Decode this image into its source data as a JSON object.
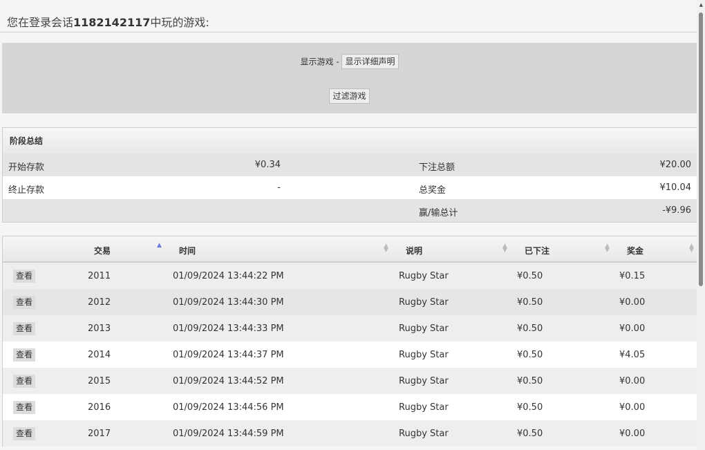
{
  "header": {
    "prefix": "您在登录会话",
    "session_id": "1182142117",
    "suffix": "中玩的游戏:"
  },
  "filter": {
    "show_games_label": "显示游戏 -",
    "show_details_button": "显示详细声明",
    "filter_button": "过滤游戏"
  },
  "summary": {
    "title": "阶段总结",
    "rows": [
      {
        "l1": "开始存款",
        "v1": "¥0.34",
        "l2": "下注总额",
        "v2": "¥20.00"
      },
      {
        "l1": "终止存款",
        "v1": "-",
        "l2": "总奖金",
        "v2": "¥10.04"
      },
      {
        "l1": "",
        "v1": "",
        "l2": "赢/输总计",
        "v2": "-¥9.96"
      }
    ]
  },
  "table": {
    "columns": [
      "交易",
      "时间",
      "说明",
      "已下注",
      "奖金"
    ],
    "view_label": "查看",
    "rows": [
      {
        "id": "2011",
        "time": "01/09/2024 13:44:22 PM",
        "desc": "Rugby Star",
        "bet": "¥0.50",
        "win": "¥0.15"
      },
      {
        "id": "2012",
        "time": "01/09/2024 13:44:30 PM",
        "desc": "Rugby Star",
        "bet": "¥0.50",
        "win": "¥0.00"
      },
      {
        "id": "2013",
        "time": "01/09/2024 13:44:33 PM",
        "desc": "Rugby Star",
        "bet": "¥0.50",
        "win": "¥0.00"
      },
      {
        "id": "2014",
        "time": "01/09/2024 13:44:37 PM",
        "desc": "Rugby Star",
        "bet": "¥0.50",
        "win": "¥4.05"
      },
      {
        "id": "2015",
        "time": "01/09/2024 13:44:52 PM",
        "desc": "Rugby Star",
        "bet": "¥0.50",
        "win": "¥0.00"
      },
      {
        "id": "2016",
        "time": "01/09/2024 13:44:56 PM",
        "desc": "Rugby Star",
        "bet": "¥0.50",
        "win": "¥0.00"
      },
      {
        "id": "2017",
        "time": "01/09/2024 13:44:59 PM",
        "desc": "Rugby Star",
        "bet": "¥0.50",
        "win": "¥0.00"
      }
    ]
  },
  "colors": {
    "sort_active": "#6a7bd6",
    "panel_bg": "#d6d6d6"
  },
  "icons": {
    "sort_asc": "sort-asc-icon",
    "sort_both": "sort-icon"
  }
}
